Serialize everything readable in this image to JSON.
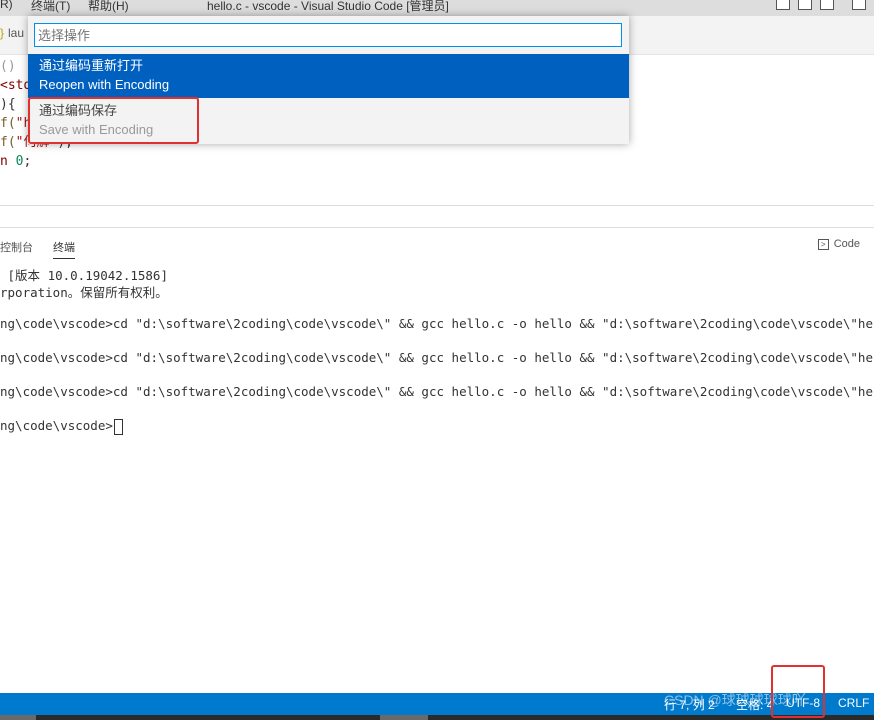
{
  "titlebar": {
    "menu_items": [
      "R)",
      "终端(T)",
      "帮助(H)"
    ],
    "window_title": "hello.c - vscode - Visual Studio Code [管理员]"
  },
  "tab": {
    "label": "lau"
  },
  "editor": {
    "lines": [
      {
        "segments": [
          {
            "t": "()",
            "c": "tok-gray"
          }
        ]
      },
      {
        "segments": [
          {
            "t": "<std",
            "c": "tok-kw"
          }
        ]
      },
      {
        "segments": [
          {
            "t": "){",
            "c": "tok-p"
          }
        ]
      },
      {
        "segments": [
          {
            "t": "f(",
            "c": "tok-fn"
          },
          {
            "t": "\"h",
            "c": "tok-str"
          }
        ]
      },
      {
        "segments": [
          {
            "t": "f(",
            "c": "tok-fn"
          },
          {
            "t": "\"何解\"",
            "c": "tok-str"
          },
          {
            "t": ");",
            "c": "tok-p"
          }
        ]
      },
      {
        "segments": [
          {
            "t": "n ",
            "c": "tok-kw"
          },
          {
            "t": "0",
            "c": "tok-num"
          },
          {
            "t": ";",
            "c": "tok-p"
          }
        ]
      }
    ]
  },
  "panel": {
    "tabs": [
      "控制台",
      "终端"
    ],
    "active_tab": "终端",
    "terminal_selector": "Code"
  },
  "terminal": {
    "lines": [
      " [版本 10.0.19042.1586]",
      "rporation。保留所有权利。",
      "",
      "ng\\code\\vscode>cd \"d:\\software\\2coding\\code\\vscode\\\" && gcc hello.c -o hello && \"d:\\software\\2coding\\code\\vscode\\\"hello",
      "",
      "ng\\code\\vscode>cd \"d:\\software\\2coding\\code\\vscode\\\" && gcc hello.c -o hello && \"d:\\software\\2coding\\code\\vscode\\\"hello",
      "",
      "ng\\code\\vscode>cd \"d:\\software\\2coding\\code\\vscode\\\" && gcc hello.c -o hello && \"d:\\software\\2coding\\code\\vscode\\\"hello",
      "",
      "ng\\code\\vscode>"
    ]
  },
  "palette": {
    "placeholder": "选择操作",
    "items": [
      {
        "zh": "通过编码重新打开",
        "en": "Reopen with Encoding"
      },
      {
        "zh": "通过编码保存",
        "en": "Save with Encoding"
      }
    ]
  },
  "statusbar": {
    "position": "行 7, 列 2",
    "spaces": "空格: 4",
    "encoding": "UTF-8",
    "eol": "CRLF"
  },
  "watermark": "CSDN @球球球球球吖",
  "colors": {
    "accent": "#007acc",
    "selection": "#0060c0",
    "highlight": "#e03030"
  }
}
